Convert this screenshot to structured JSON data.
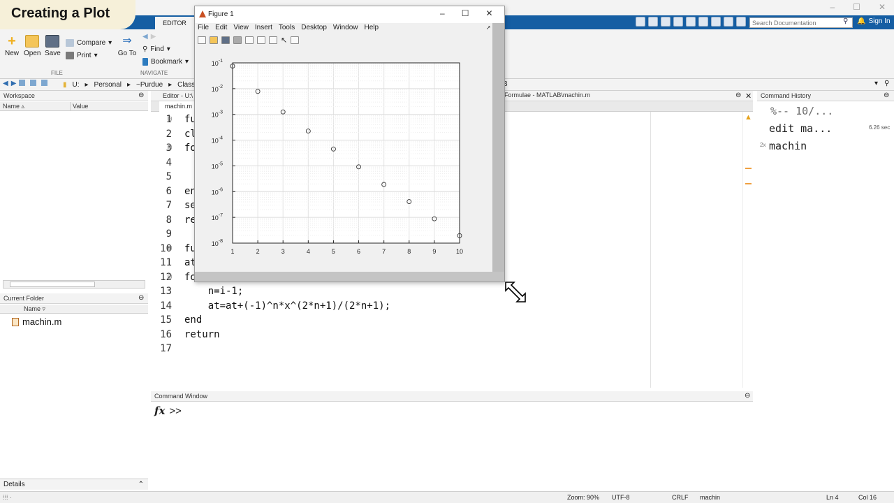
{
  "video_title": "Creating a Plot",
  "ribbon": {
    "tab_editor": "EDITOR",
    "new": "New",
    "open": "Open",
    "save": "Save",
    "compare": "Compare",
    "print": "Print",
    "file_section": "FILE",
    "goto": "Go To",
    "find": "Find",
    "bookmark": "Bookmark",
    "navigate_section": "NAVIGATE"
  },
  "search": {
    "placeholder": "Search Documentation"
  },
  "sign_in": "Sign In",
  "address": [
    "U:",
    "Personal",
    "~Purdue",
    "Classes"
  ],
  "address_tail": "B",
  "workspace": {
    "title": "Workspace",
    "col_name": "Name ▵",
    "col_value": "Value"
  },
  "current_folder": {
    "title": "Current Folder",
    "col_name": "Name ▿",
    "files": [
      "machin.m"
    ]
  },
  "details": "Details",
  "editor": {
    "title": "Editor - U:\\",
    "title_right": "Formulae - MATLAB\\machin.m",
    "tab": "machin.m",
    "line_numbers": [
      "1",
      "2",
      "3",
      "4",
      "5",
      "6",
      "7",
      "8",
      "9",
      "10",
      "11",
      "12",
      "13",
      "14",
      "15",
      "16",
      "17"
    ],
    "lines": [
      "fu",
      "cl",
      "fo",
      "",
      "",
      "en",
      "se",
      "re",
      "",
      "fu",
      "at",
      "fo",
      "    n=i-1;",
      "    at=at+(-1)^n*x^(2*n+1)/(2*n+1);",
      "end",
      "return",
      ""
    ]
  },
  "command_window": {
    "title": "Command Window",
    "fx": "fx",
    "prompt": ">>"
  },
  "history": {
    "title": "Command History",
    "items": [
      "%-- 10/...",
      "edit ma...",
      "machin"
    ],
    "time": "6.26 sec",
    "count": "2x"
  },
  "status": {
    "zoom": "Zoom: 90%",
    "encoding": "UTF-8",
    "eol": "CRLF",
    "file": "machin",
    "ln": "Ln 4",
    "col": "Col 16"
  },
  "figure": {
    "title": "Figure 1",
    "menu": [
      "File",
      "Edit",
      "View",
      "Insert",
      "Tools",
      "Desktop",
      "Window",
      "Help"
    ]
  },
  "chart_data": {
    "type": "scatter",
    "title": "",
    "xlabel": "",
    "ylabel": "",
    "y_scale": "log",
    "xlim": [
      1,
      10
    ],
    "ylim": [
      1e-08,
      0.1
    ],
    "x_ticks": [
      "1",
      "2",
      "3",
      "4",
      "5",
      "6",
      "7",
      "8",
      "9",
      "10"
    ],
    "y_ticks": [
      {
        "base": "10",
        "exp": "-8",
        "value": 1e-08
      },
      {
        "base": "10",
        "exp": "-7",
        "value": 1e-07
      },
      {
        "base": "10",
        "exp": "-6",
        "value": 1e-06
      },
      {
        "base": "10",
        "exp": "-5",
        "value": 1e-05
      },
      {
        "base": "10",
        "exp": "-4",
        "value": 0.0001
      },
      {
        "base": "10",
        "exp": "-3",
        "value": 0.001
      },
      {
        "base": "10",
        "exp": "-2",
        "value": 0.01
      },
      {
        "base": "10",
        "exp": "-1",
        "value": 0.1
      }
    ],
    "grid": true,
    "marker": "circle",
    "x": [
      1,
      2,
      3,
      4,
      5,
      6,
      7,
      8,
      9,
      10
    ],
    "y": [
      0.075,
      0.0078,
      0.00125,
      0.000225,
      4.5e-05,
      9.2e-06,
      1.9e-06,
      4.1e-07,
      8.8e-08,
      1.95e-08
    ]
  }
}
